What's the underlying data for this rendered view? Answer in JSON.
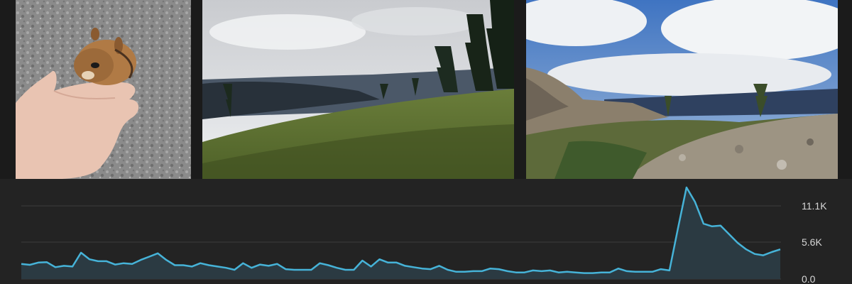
{
  "photos": [
    {
      "name": "chipmunk-in-hand-photo"
    },
    {
      "name": "alpine-meadow-photo"
    },
    {
      "name": "rocky-ridge-photo"
    }
  ],
  "colors": {
    "background": "#232323",
    "line": "#46b3d8",
    "area": "#2b3a42",
    "grid": "#3c3c3c",
    "tick_text": "#d7d7d7"
  },
  "chart_data": {
    "type": "area",
    "y_ticks": [
      {
        "value": 11100,
        "label": "11.1K"
      },
      {
        "value": 5600,
        "label": "5.6K"
      },
      {
        "value": 0,
        "label": "0.0"
      }
    ],
    "ylim": [
      0,
      11100
    ],
    "grid": true,
    "x": [
      1,
      2,
      3,
      4,
      5,
      6,
      7,
      8,
      9,
      10,
      11,
      12,
      13,
      14,
      15,
      16,
      17,
      18,
      19,
      20,
      21,
      22,
      23,
      24,
      25,
      26,
      27,
      28,
      29,
      30,
      31,
      32,
      33,
      34,
      35,
      36,
      37,
      38,
      39,
      40,
      41,
      42,
      43,
      44,
      45,
      46,
      47,
      48,
      49,
      50,
      51,
      52,
      53,
      54,
      55,
      56,
      57,
      58,
      59,
      60,
      61,
      62,
      63,
      64,
      65,
      66,
      67,
      68,
      69,
      70,
      71,
      72,
      73,
      74,
      75,
      76,
      77,
      78,
      79,
      80,
      81,
      82,
      83,
      84,
      85,
      86,
      87,
      88,
      89,
      90,
      91,
      92,
      93,
      94,
      95,
      96,
      97,
      98,
      99,
      100,
      101
    ],
    "values": [
      2300,
      2150,
      2500,
      2550,
      1800,
      2000,
      1900,
      4000,
      3000,
      2700,
      2700,
      2200,
      2400,
      2300,
      2900,
      3400,
      3900,
      2900,
      2100,
      2100,
      1900,
      2400,
      2100,
      1900,
      1700,
      1400,
      2400,
      1700,
      2200,
      2000,
      2300,
      1500,
      1400,
      1400,
      1400,
      2400,
      2100,
      1700,
      1400,
      1400,
      2800,
      1900,
      3000,
      2500,
      2500,
      2000,
      1800,
      1600,
      1500,
      2000,
      1400,
      1100,
      1100,
      1200,
      1200,
      1600,
      1500,
      1200,
      1000,
      1000,
      1300,
      1200,
      1300,
      1000,
      1100,
      1000,
      900,
      900,
      1000,
      1000,
      1600,
      1200,
      1100,
      1100,
      1100,
      1500,
      1300,
      7700,
      13900,
      11700,
      8400,
      8000,
      8100,
      6800,
      5500,
      4500,
      3800,
      3600,
      4100,
      4500
    ],
    "start_x": 30,
    "end_x": 1099
  }
}
